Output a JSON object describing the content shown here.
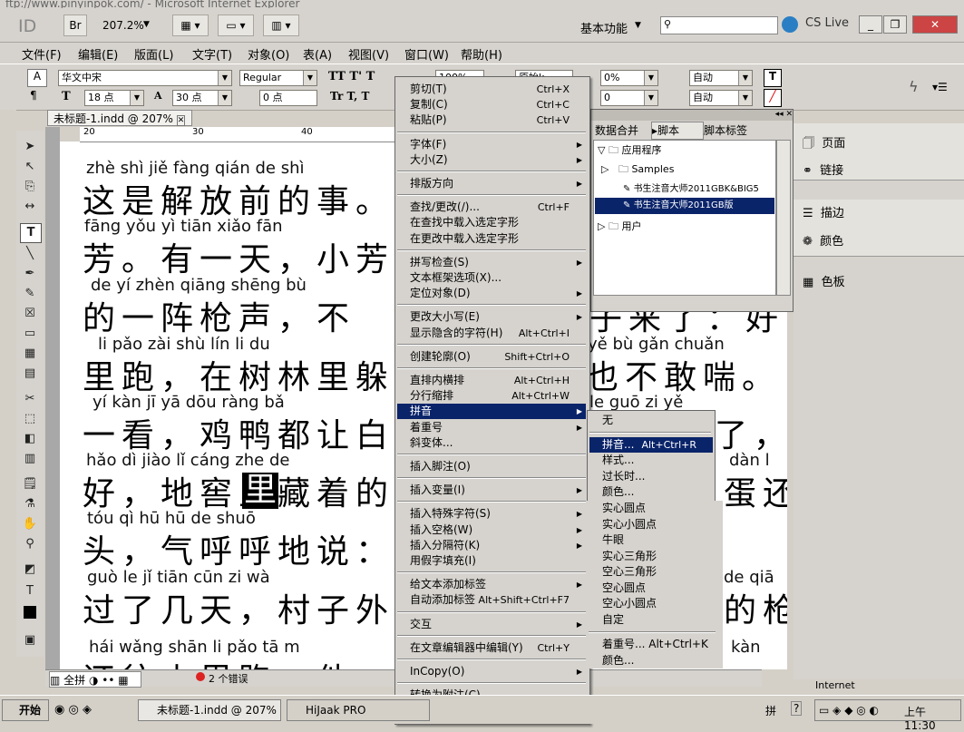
{
  "ie_title": "ftp://www.pinyinpok.com/ - Microsoft Internet Explorer",
  "app": {
    "logo": "ID",
    "zoom": "207.2%",
    "workspace": "基本功能",
    "cs_live": "CS Live"
  },
  "menubar": [
    "文件(F)",
    "编辑(E)",
    "版面(L)",
    "文字(T)",
    "对象(O)",
    "表(A)",
    "视图(V)",
    "窗口(W)",
    "帮助(H)"
  ],
  "controlbar": {
    "font": "华文中宋",
    "style": "Regular",
    "size": "18 点",
    "leading": "30 点",
    "kerning": "0 点",
    "scale": "100%",
    "tracking": "0%",
    "baseline": "0",
    "lang1": "自动",
    "lang2": "自动",
    "char_style": "原始k"
  },
  "document": {
    "tab": "未标题-1.indd @ 207%",
    "ruler_ticks": [
      "20",
      "30",
      "40",
      "50",
      "60",
      "70"
    ],
    "lines": [
      {
        "pinyin": "zhè  shì  jiě  fàng qián  de   shì",
        "hanzi": "这是解放前的事。"
      },
      {
        "pinyin": "fāng       yǒu  yì  tiān      xiǎo fān",
        "hanzi": "芳。有一天，小芳"
      },
      {
        "pinyin": "de    yí   zhèn qiāng shēng          bù",
        "hanzi": "的一阵枪声，不"
      },
      {
        "pinyin": "li    pǎo        zài  shù  lín    li   du",
        "hanzi": "里跑，在树林里躲"
      },
      {
        "pinyin": "yí   kàn        jī    yā  dōu ràng bǎ",
        "hanzi": "一看，鸡鸭都让白"
      },
      {
        "pinyin": "hǎo        dì   jiào   lǐ  cáng zhe  de",
        "hanzi": "好，地窖里藏着的"
      },
      {
        "pinyin": "tóu        qì   hū   hū   de  shuō",
        "hanzi": "头，气呼呼地说："
      },
      {
        "pinyin": "guò   le    jǐ   tiān        cūn   zi   wà",
        "hanzi": "过了几天，村子外"
      },
      {
        "pinyin": "hái  wǎng shān   li   pǎo         tā  m",
        "hanzi": "还往山里跑，他"
      }
    ],
    "right_lines": [
      {
        "pinyin": "yě   bù  gǎn chuǎn",
        "hanzi": "也不敢喘。"
      },
      {
        "pinyin": "le          guō   zi   yě",
        "hanzi": "了，锅子也"
      },
      {
        "pinyin": "dàn  l",
        "hanzi": "蛋还"
      },
      {
        "pinyin": "de  qiā",
        "hanzi": "的枪"
      },
      {
        "pinyin": "kàn",
        "hanzi": "看"
      },
      {
        "pinyin": "",
        "hanzi": "子来了：好"
      }
    ],
    "highlight_char": "里",
    "status": {
      "errors": "2 个错误",
      "mode": "全拼"
    }
  },
  "script_panel": {
    "tabs": [
      "数据合并",
      "脚本",
      "脚本标签"
    ],
    "items": [
      "应用程序",
      "Samples",
      "书生注音大师2011GBK&BIG5",
      "书生注音大师2011GB版",
      "用户"
    ]
  },
  "dock": [
    "页面",
    "链接",
    "描边",
    "颜色",
    "色板"
  ],
  "context_menu": [
    {
      "label": "剪切(T)",
      "shortcut": "Ctrl+X"
    },
    {
      "label": "复制(C)",
      "shortcut": "Ctrl+C"
    },
    {
      "label": "粘贴(P)",
      "shortcut": "Ctrl+V"
    },
    {
      "sep": true
    },
    {
      "label": "字体(F)",
      "sub": true
    },
    {
      "label": "大小(Z)",
      "sub": true
    },
    {
      "sep": true
    },
    {
      "label": "排版方向",
      "sub": true
    },
    {
      "sep": true
    },
    {
      "label": "查找/更改(/)...",
      "shortcut": "Ctrl+F"
    },
    {
      "label": "在查找中载入选定字形"
    },
    {
      "label": "在更改中载入选定字形"
    },
    {
      "sep": true
    },
    {
      "label": "拼写检查(S)",
      "sub": true
    },
    {
      "label": "文本框架选项(X)..."
    },
    {
      "label": "定位对象(D)",
      "sub": true
    },
    {
      "sep": true
    },
    {
      "label": "更改大小写(E)",
      "sub": true
    },
    {
      "label": "显示隐含的字符(H)",
      "shortcut": "Alt+Ctrl+I"
    },
    {
      "sep": true
    },
    {
      "label": "创建轮廓(O)",
      "shortcut": "Shift+Ctrl+O"
    },
    {
      "sep": true
    },
    {
      "label": "直排内横排",
      "shortcut": "Alt+Ctrl+H"
    },
    {
      "label": "分行缩排",
      "shortcut": "Alt+Ctrl+W"
    },
    {
      "label": "拼音",
      "sub": true,
      "selected": true
    },
    {
      "label": "着重号",
      "sub": true
    },
    {
      "label": "斜变体..."
    },
    {
      "sep": true
    },
    {
      "label": "插入脚注(O)"
    },
    {
      "sep": true
    },
    {
      "label": "插入变量(I)",
      "sub": true
    },
    {
      "sep": true
    },
    {
      "label": "插入特殊字符(S)",
      "sub": true
    },
    {
      "label": "插入空格(W)",
      "sub": true
    },
    {
      "label": "插入分隔符(K)",
      "sub": true
    },
    {
      "label": "用假字填充(I)"
    },
    {
      "sep": true
    },
    {
      "label": "给文本添加标签",
      "sub": true
    },
    {
      "label": "自动添加标签",
      "shortcut": "Alt+Shift+Ctrl+F7"
    },
    {
      "sep": true
    },
    {
      "label": "交互",
      "sub": true
    },
    {
      "sep": true
    },
    {
      "label": "在文章编辑器中编辑(Y)",
      "shortcut": "Ctrl+Y"
    },
    {
      "sep": true
    },
    {
      "label": "InCopy(O)",
      "sub": true
    },
    {
      "sep": true
    },
    {
      "label": "转换为附注(C)"
    }
  ],
  "submenu_pinyin": [
    {
      "label": "无"
    },
    {
      "sep": true
    },
    {
      "label": "拼音...",
      "shortcut": "Alt+Ctrl+R",
      "selected": true
    },
    {
      "label": "样式..."
    },
    {
      "label": "过长时..."
    },
    {
      "label": "颜色..."
    }
  ],
  "submenu_emphasis": [
    "实心圆点",
    "实心小圆点",
    "牛眼",
    "实心三角形",
    "空心三角形",
    "空心圆点",
    "空心小圆点",
    "自定"
  ],
  "submenu_emphasis_bottom": [
    {
      "label": "着重号...",
      "shortcut": "Alt+Ctrl+K"
    },
    {
      "label": "颜色..."
    }
  ],
  "ie_status": "Internet",
  "taskbar": {
    "start": "开始",
    "tasks": [
      "未标题-1.indd @ 207%",
      "HiJaak PRO"
    ],
    "time": "上午 11:30"
  }
}
